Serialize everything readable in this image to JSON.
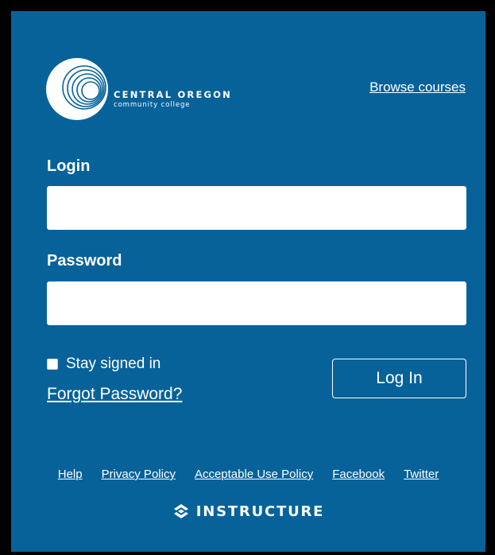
{
  "colors": {
    "background": "#07629a",
    "frame": "#000000",
    "text": "#ffffff",
    "input_background": "#ffffff"
  },
  "branding": {
    "logo_icon": "concentric-circles-logo-icon",
    "name_line1": "CENTRAL OREGON",
    "name_line2": "community college"
  },
  "header": {
    "browse_courses": "Browse courses"
  },
  "form": {
    "login_label": "Login",
    "login_value": "",
    "password_label": "Password",
    "password_value": "",
    "stay_signed_in_label": "Stay signed in",
    "stay_signed_in_checked": false,
    "forgot_password": "Forgot Password?",
    "login_button": "Log In"
  },
  "footer": {
    "links": [
      {
        "label": "Help"
      },
      {
        "label": "Privacy Policy"
      },
      {
        "label": "Acceptable Use Policy"
      },
      {
        "label": "Facebook"
      },
      {
        "label": "Twitter"
      }
    ],
    "powered_by_icon": "instructure-icon",
    "powered_by": "INSTRUCTURE"
  }
}
